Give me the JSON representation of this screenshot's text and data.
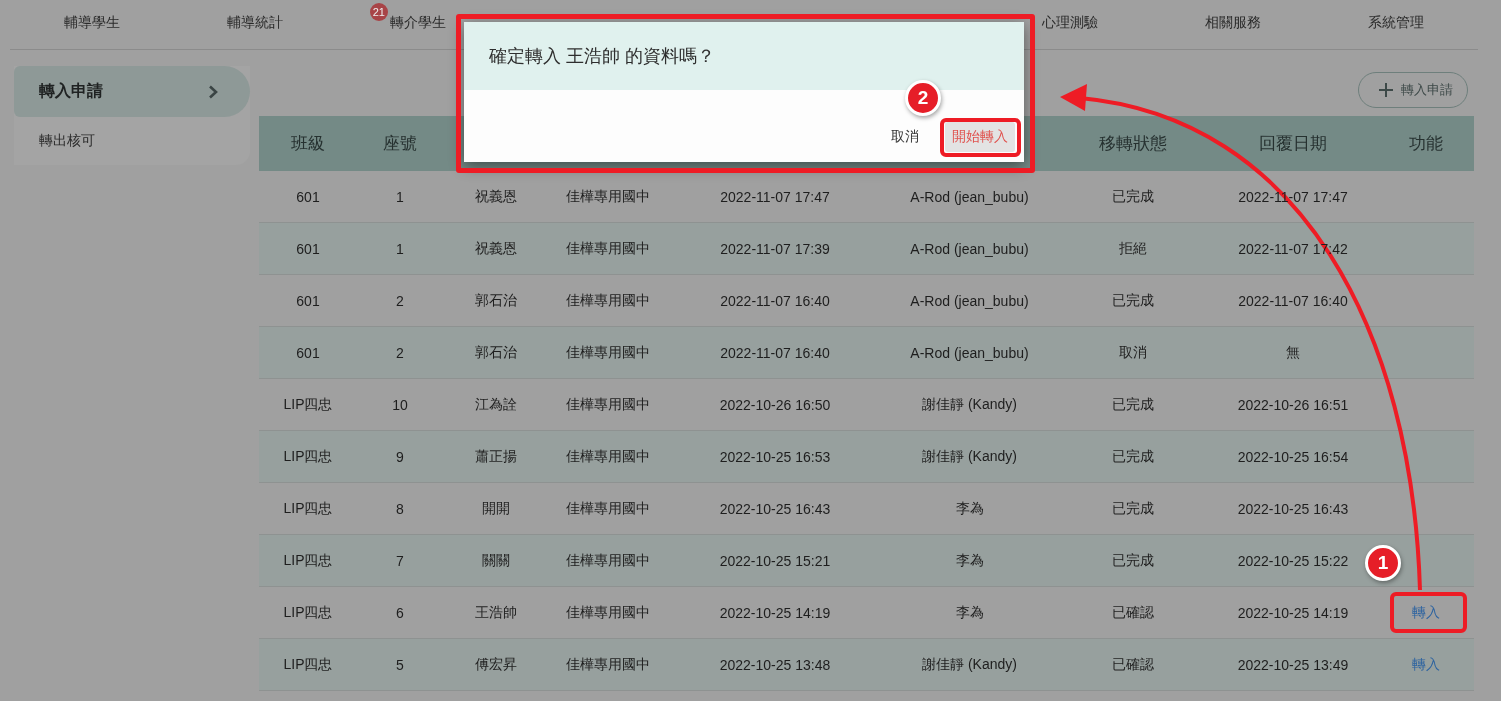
{
  "nav": {
    "items": [
      {
        "label": "輔導學生"
      },
      {
        "label": "輔導統計"
      },
      {
        "label": "轉介學生",
        "badge": "21"
      },
      {
        "label": "心理測驗"
      },
      {
        "label": "相關服務"
      },
      {
        "label": "系統管理"
      }
    ]
  },
  "sidebar": {
    "items": [
      {
        "label": "轉入申請",
        "selected": true
      },
      {
        "label": "轉出核可",
        "selected": false
      }
    ]
  },
  "toolbar": {
    "add_button": "轉入申請"
  },
  "table": {
    "columns": [
      "班級",
      "座號",
      "",
      "",
      "",
      "",
      "移轉狀態",
      "回覆日期",
      "功能"
    ],
    "rows": [
      {
        "cells": [
          "601",
          "1",
          "祝義恩",
          "佳樺專用國中",
          "2022-11-07 17:47",
          "A-Rod (jean_bubu)",
          "已完成",
          "2022-11-07 17:47"
        ]
      },
      {
        "cells": [
          "601",
          "1",
          "祝義恩",
          "佳樺專用國中",
          "2022-11-07 17:39",
          "A-Rod (jean_bubu)",
          "拒絕",
          "2022-11-07 17:42"
        ]
      },
      {
        "cells": [
          "601",
          "2",
          "郭石治",
          "佳樺專用國中",
          "2022-11-07 16:40",
          "A-Rod (jean_bubu)",
          "已完成",
          "2022-11-07 16:40"
        ]
      },
      {
        "cells": [
          "601",
          "2",
          "郭石治",
          "佳樺專用國中",
          "2022-11-07 16:40",
          "A-Rod (jean_bubu)",
          "取消",
          "無"
        ]
      },
      {
        "cells": [
          "LIP四忠",
          "10",
          "江為詮",
          "佳樺專用國中",
          "2022-10-26 16:50",
          "謝佳靜 (Kandy)",
          "已完成",
          "2022-10-26 16:51"
        ]
      },
      {
        "cells": [
          "LIP四忠",
          "9",
          "蕭正揚",
          "佳樺專用國中",
          "2022-10-25 16:53",
          "謝佳靜 (Kandy)",
          "已完成",
          "2022-10-25 16:54"
        ]
      },
      {
        "cells": [
          "LIP四忠",
          "8",
          "開開",
          "佳樺專用國中",
          "2022-10-25 16:43",
          "李為",
          "已完成",
          "2022-10-25 16:43"
        ]
      },
      {
        "cells": [
          "LIP四忠",
          "7",
          "關關",
          "佳樺專用國中",
          "2022-10-25 15:21",
          "李為",
          "已完成",
          "2022-10-25 15:22"
        ]
      },
      {
        "cells": [
          "LIP四忠",
          "6",
          "王浩帥",
          "佳樺專用國中",
          "2022-10-25 14:19",
          "李為",
          "已確認",
          "2022-10-25 14:19"
        ],
        "action": "轉入"
      },
      {
        "cells": [
          "LIP四忠",
          "5",
          "傅宏昇",
          "佳樺專用國中",
          "2022-10-25 13:48",
          "謝佳靜 (Kandy)",
          "已確認",
          "2022-10-25 13:49"
        ],
        "action": "轉入"
      }
    ]
  },
  "dialog": {
    "message": "確定轉入 王浩帥 的資料嗎？",
    "buttons": [
      {
        "label": "取消",
        "kind": "text"
      },
      {
        "label": "開始轉入",
        "kind": "primary"
      }
    ]
  },
  "callouts": [
    {
      "number": "1"
    },
    {
      "number": "2"
    }
  ]
}
